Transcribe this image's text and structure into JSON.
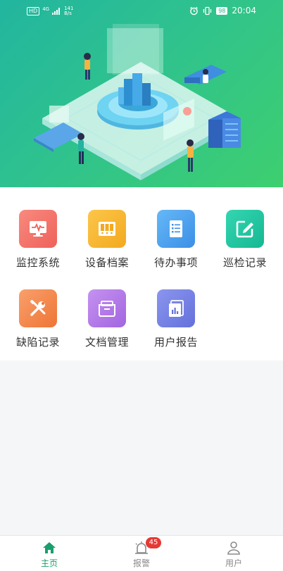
{
  "status_bar": {
    "hd": "HD",
    "network": "4G",
    "speed_value": "141",
    "speed_unit": "B/s",
    "battery": "98",
    "time": "20:04"
  },
  "menu": {
    "items": [
      {
        "label": "监控系统",
        "icon": "monitor-pulse-icon",
        "color": "#f2716b"
      },
      {
        "label": "设备档案",
        "icon": "archive-drawers-icon",
        "color": "#f7b733"
      },
      {
        "label": "待办事项",
        "icon": "todo-list-icon",
        "color": "#4aa3f0"
      },
      {
        "label": "巡检记录",
        "icon": "edit-record-icon",
        "color": "#20c7a5"
      },
      {
        "label": "缺陷记录",
        "icon": "wrench-screwdriver-icon",
        "color": "#f58a4f"
      },
      {
        "label": "文档管理",
        "icon": "folder-docs-icon",
        "color": "#b57ae6"
      },
      {
        "label": "用户报告",
        "icon": "report-chart-icon",
        "color": "#7b86e8"
      }
    ]
  },
  "tabbar": {
    "tabs": [
      {
        "label": "主页",
        "icon": "home-icon",
        "active": true
      },
      {
        "label": "报警",
        "icon": "alarm-icon",
        "badge": "45"
      },
      {
        "label": "用户",
        "icon": "user-icon"
      }
    ],
    "active_color": "#1a9f6e",
    "badge_color": "#e53935"
  }
}
